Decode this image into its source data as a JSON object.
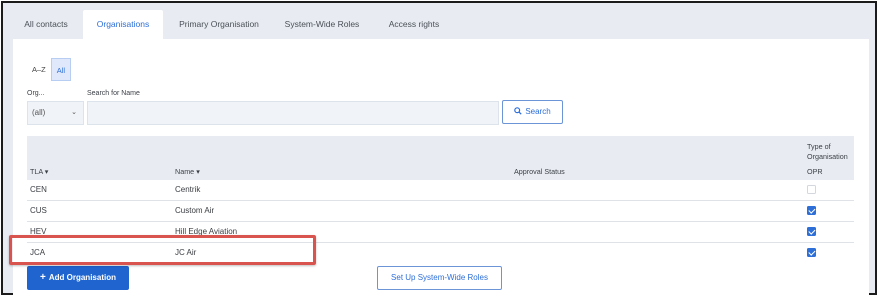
{
  "tabs": [
    {
      "label": "All contacts"
    },
    {
      "label": "Organisations"
    },
    {
      "label": "Primary Organisation"
    },
    {
      "label": "System-Wide Roles"
    },
    {
      "label": "Access rights"
    }
  ],
  "active_tab": "Organisations",
  "filters": {
    "az_label": "A–Z",
    "all_label": "All",
    "org_label": "Org...",
    "org_value": "(all)",
    "search_label": "Search for Name",
    "search_value": "",
    "search_button": "Search"
  },
  "table": {
    "group_header": "Type of Organisation",
    "columns": [
      "TLA",
      "Name",
      "Approval Status",
      "OPR"
    ],
    "rows": [
      {
        "tla": "CEN",
        "name": "Centrik",
        "status": "",
        "opr": false
      },
      {
        "tla": "CUS",
        "name": "Custom Air",
        "status": "",
        "opr": true
      },
      {
        "tla": "HEV",
        "name": "Hill Edge Aviation",
        "status": "",
        "opr": true
      },
      {
        "tla": "JCA",
        "name": "JC Air",
        "status": "",
        "opr": true
      }
    ]
  },
  "buttons": {
    "add_org": "Add Organisation",
    "setup_roles": "Set Up System-Wide Roles"
  },
  "colors": {
    "accent": "#2e6fd8",
    "primary_button": "#2065cf",
    "highlight": "#d9534f"
  }
}
